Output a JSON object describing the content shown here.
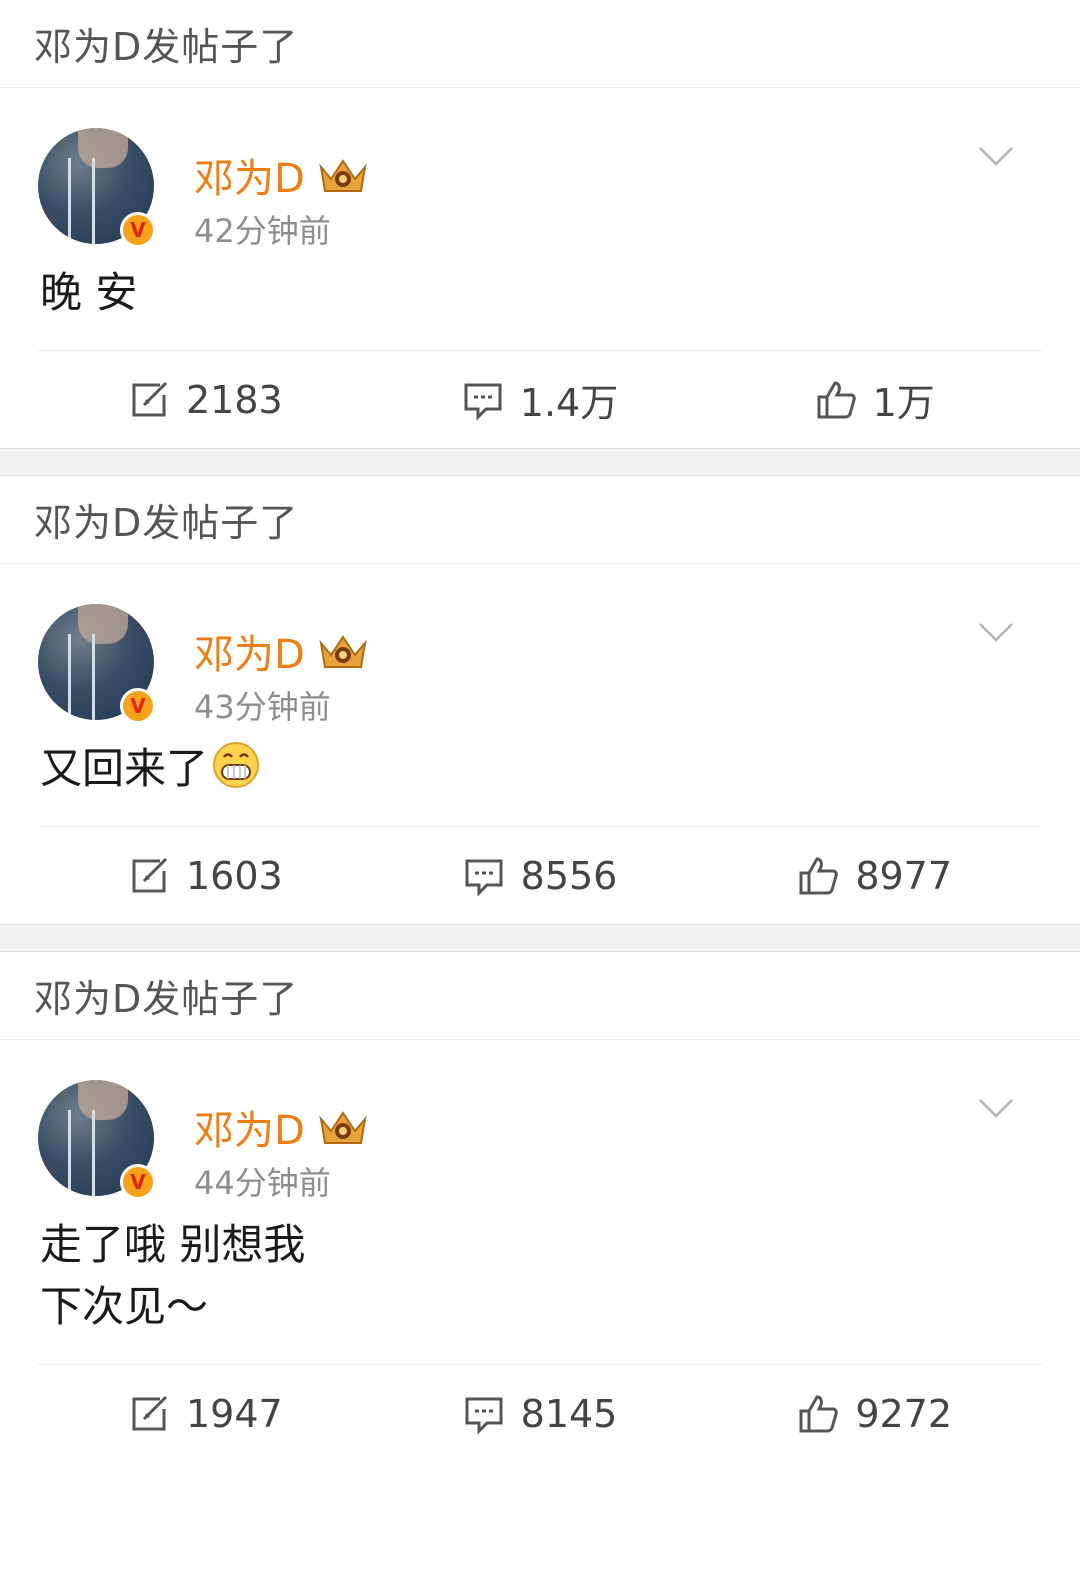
{
  "posts": [
    {
      "notice": "邓为D发帖子了",
      "author": "邓为D",
      "time": "42分钟前",
      "content": [
        "晚 安"
      ],
      "has_emoji": false,
      "repost": "2183",
      "comments": "1.4万",
      "likes": "1万"
    },
    {
      "notice": "邓为D发帖子了",
      "author": "邓为D",
      "time": "43分钟前",
      "content": [
        "又回来了"
      ],
      "has_emoji": true,
      "repost": "1603",
      "comments": "8556",
      "likes": "8977"
    },
    {
      "notice": "邓为D发帖子了",
      "author": "邓为D",
      "time": "44分钟前",
      "content": [
        "走了哦 别想我",
        "下次见～"
      ],
      "has_emoji": false,
      "repost": "1947",
      "comments": "8145",
      "likes": "9272"
    }
  ],
  "icons": {
    "repost": "repost-icon",
    "comment": "comment-icon",
    "like": "thumbs-up-icon",
    "more": "chevron-down-icon",
    "verified": "verified-v-badge",
    "vip": "crown-icon",
    "emoji": "grinning-emoji"
  },
  "colors": {
    "author_name": "#f07c14",
    "verified_badge": "#f7a21b",
    "timestamp": "#8e8e8e"
  }
}
